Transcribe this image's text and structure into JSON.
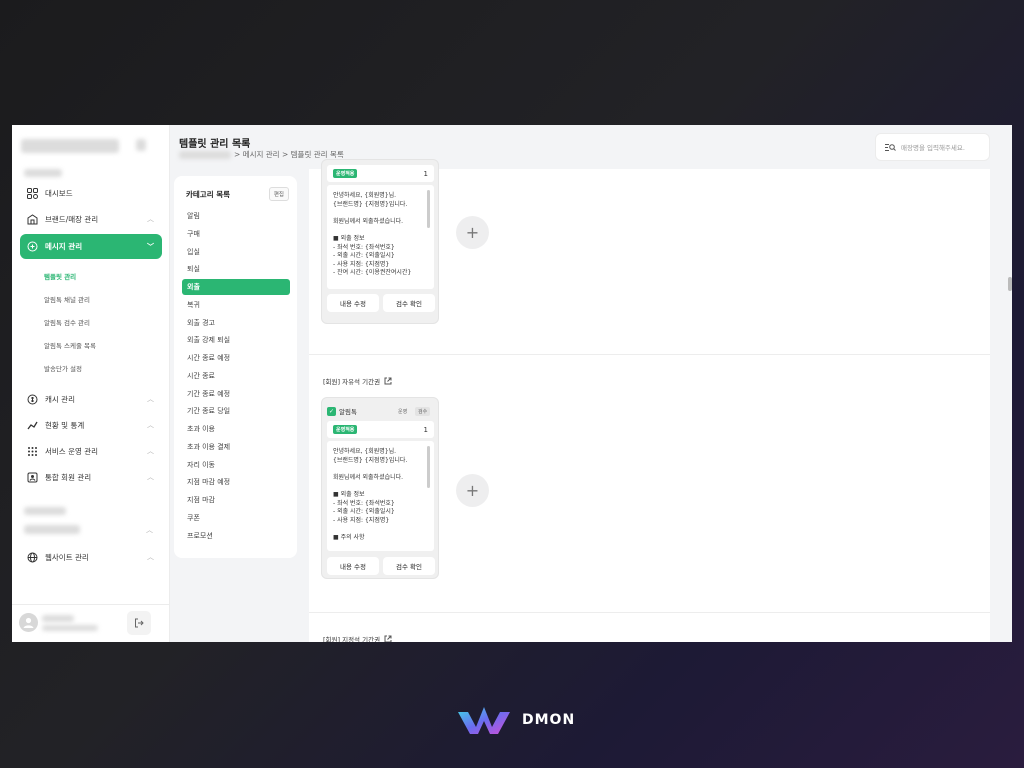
{
  "sidebar": {
    "nav": [
      {
        "label": "대시보드",
        "icon": "dashboard-icon"
      },
      {
        "label": "브랜드/매장 관리",
        "icon": "store-icon"
      },
      {
        "label": "메시지 관리",
        "icon": "message-icon"
      }
    ],
    "sub": [
      "템플릿 관리",
      "알림톡 채널 관리",
      "알림톡 검수 관리",
      "알림톡 스케줄 목록",
      "발송단가 설정"
    ],
    "nav2": [
      {
        "label": "캐시 관리",
        "icon": "cash-icon"
      },
      {
        "label": "현황 및 통계",
        "icon": "chart-icon"
      },
      {
        "label": "서비스 운영 관리",
        "icon": "grid-icon"
      },
      {
        "label": "통합 회원 관리",
        "icon": "member-icon"
      }
    ],
    "nav3": [
      {
        "label": "웹사이트 관리",
        "icon": "globe-icon"
      }
    ]
  },
  "header": {
    "title": "템플릿 관리 목록",
    "crumbs": [
      "메시지 관리",
      "템플릿 관리 목록"
    ],
    "search_placeholder": "매장명을 입력해주세요."
  },
  "category": {
    "title": "카테고리 목록",
    "edit": "편집",
    "items": [
      "알림",
      "구매",
      "입실",
      "퇴실",
      "외출",
      "복귀",
      "외출 경고",
      "외출 강제 퇴실",
      "시간 종료 예정",
      "시간 종료",
      "기간 종료 예정",
      "기간 종료 당일",
      "초과 이용",
      "초과 이용 결제",
      "자리 이동",
      "지점 마감 예정",
      "지점 마감",
      "쿠폰",
      "프로모션"
    ],
    "selected": 4
  },
  "sections": [
    {
      "label": "",
      "channel": "",
      "status": "운영적용",
      "count": "1",
      "message": "안녕하세요, {회원명}님.\n{브랜드명} {지점명}입니다.\n\n회원님께서 외출하셨습니다.\n\n■ 외출 정보\n- 좌석 번호: {좌석번호}\n- 외출 시간: {외출일시}\n- 사용 지점: {지점명}\n- 잔여 시간: {이용권잔여시간}",
      "btn_edit": "내용 수정",
      "btn_check": "검수 확인"
    },
    {
      "label": "[회원] 자유석 기간권",
      "channel": "알림톡",
      "tag1": "운영",
      "tag2": "검수",
      "status": "운영적용",
      "count": "1",
      "message": "안녕하세요, {회원명}님.\n{브랜드명} {지점명}입니다.\n\n회원님께서 외출하셨습니다.\n\n■ 외출 정보\n- 좌석 번호: {좌석번호}\n- 외출 시간: {외출일시}\n- 사용 지점: {지점명}\n\n■ 주의 사항",
      "btn_edit": "내용 수정",
      "btn_check": "검수 확인"
    },
    {
      "label": "[회원] 지정석 기간권"
    }
  ],
  "brand": {
    "name": "DMON"
  }
}
